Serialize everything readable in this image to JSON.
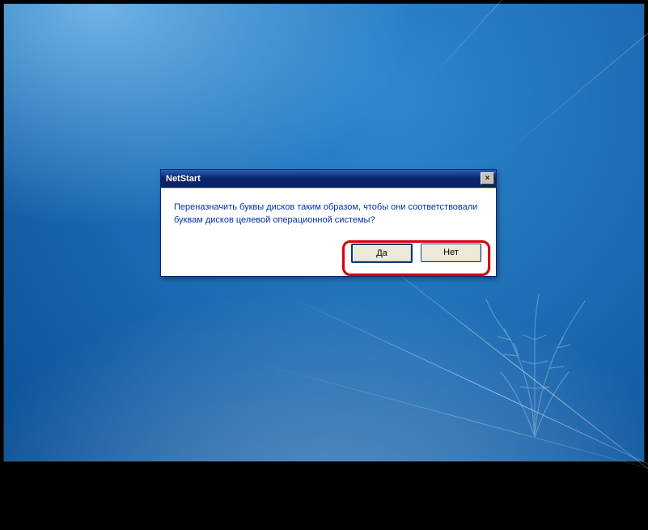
{
  "dialog": {
    "title": "NetStart",
    "close_label": "×",
    "message": "Переназначить буквы дисков таким образом, чтобы они соответствовали буквам дисков целевой операционной системы?",
    "yes_label": "Да",
    "no_label": "Нет"
  }
}
